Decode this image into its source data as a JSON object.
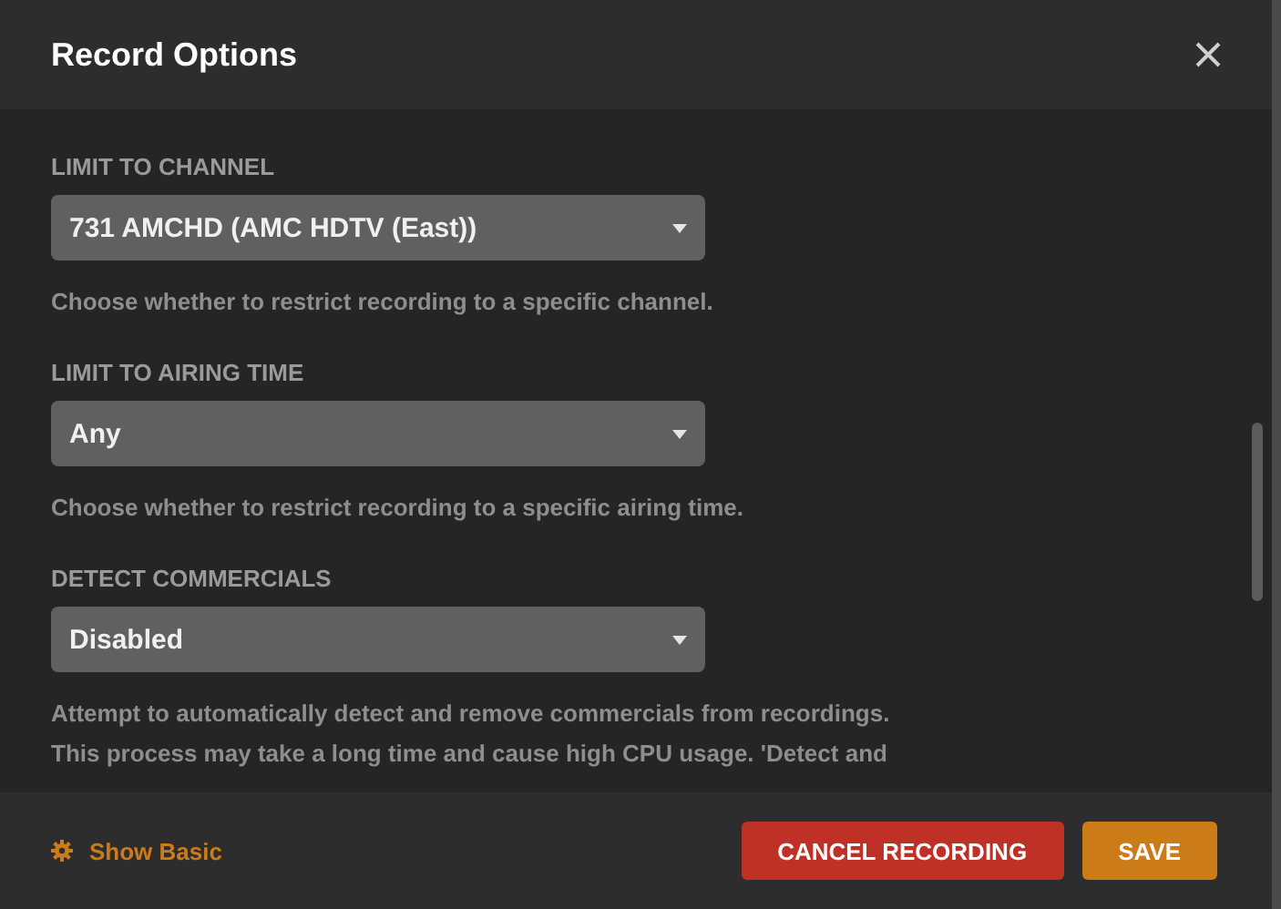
{
  "window": {
    "title": "Record Options"
  },
  "fields": [
    {
      "label": "LIMIT TO CHANNEL",
      "value": "731 AMCHD (AMC HDTV (East))",
      "hint": [
        "Choose whether to restrict recording to a specific channel."
      ]
    },
    {
      "label": "LIMIT TO AIRING TIME",
      "value": "Any",
      "hint": [
        "Choose whether to restrict recording to a specific airing time."
      ]
    },
    {
      "label": "DETECT COMMERCIALS",
      "value": "Disabled",
      "hint": [
        "Attempt to automatically detect and remove commercials from recordings.",
        "This process may take a long time and cause high CPU usage. 'Detect and"
      ]
    }
  ],
  "footer": {
    "toggle": "Show Basic",
    "buttons": [
      {
        "label": "CANCEL RECORDING",
        "kind": "danger"
      },
      {
        "label": "SAVE",
        "kind": "primary"
      }
    ]
  }
}
